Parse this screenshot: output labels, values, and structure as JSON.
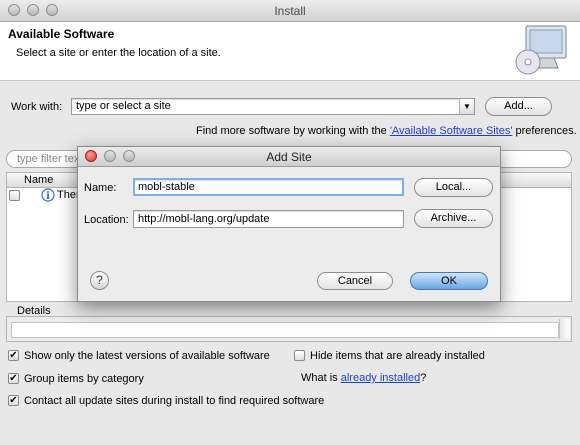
{
  "window": {
    "title": "Install"
  },
  "banner": {
    "title": "Available Software",
    "subtitle": "Select a site or enter the location of a site."
  },
  "work_with": {
    "label": "Work with:",
    "value": "type or select a site",
    "add_label": "Add..."
  },
  "find_more": {
    "prefix": "Find more software by working with the ",
    "link": "'Available Software Sites'",
    "suffix": " preferences."
  },
  "filter": {
    "placeholder": "type filter tex"
  },
  "table": {
    "col_name": "Name",
    "row_text": "Ther"
  },
  "details": {
    "label": "Details"
  },
  "options": {
    "show_latest": "Show only the latest versions of available software",
    "hide_installed": "Hide items that are already installed",
    "group_by_category": "Group items by category",
    "what_is_prefix": "What is ",
    "what_is_link": "already installed",
    "what_is_suffix": "?",
    "contact_all": "Contact all update sites during install to find required software"
  },
  "dialog": {
    "title": "Add Site",
    "name_label": "Name:",
    "name_value": "mobl-stable",
    "local_label": "Local...",
    "location_label": "Location:",
    "location_value": "http://mobl-lang.org/update",
    "archive_label": "Archive...",
    "cancel_label": "Cancel",
    "ok_label": "OK",
    "help_glyph": "?"
  },
  "checks": {
    "show_latest": true,
    "hide_installed": false,
    "group_by_category": true,
    "contact_all": true
  },
  "colors": {
    "accent": "#4a90d9",
    "link": "#1e3fd1",
    "close": "#e0443e"
  },
  "icons": [
    "close-icon",
    "minimize-icon",
    "zoom-icon",
    "install-computer-icon",
    "dropdown-arrow-icon",
    "info-icon",
    "help-icon",
    "checkmark-icon"
  ]
}
